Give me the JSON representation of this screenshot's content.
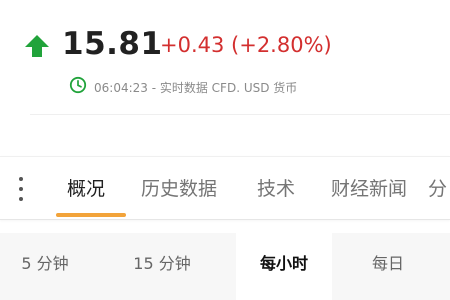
{
  "quote": {
    "direction_icon": "arrow-up-icon",
    "price": "15.81",
    "change": "+0.43 (+2.80%)",
    "status_icon": "clock-icon",
    "status": "06:04:23 - 实时数据 CFD. USD 货币",
    "up_color": "#21a33b",
    "change_color": "#d32f2f"
  },
  "tabs": {
    "more_icon": "more-vertical-icon",
    "items": [
      "概况",
      "历史数据",
      "技术",
      "财经新闻",
      "分"
    ],
    "active": "概况",
    "accent_color": "#f2a33a"
  },
  "intervals": {
    "items": [
      "5 分钟",
      "15 分钟",
      "每小时",
      "每日"
    ],
    "active": "每小时"
  }
}
